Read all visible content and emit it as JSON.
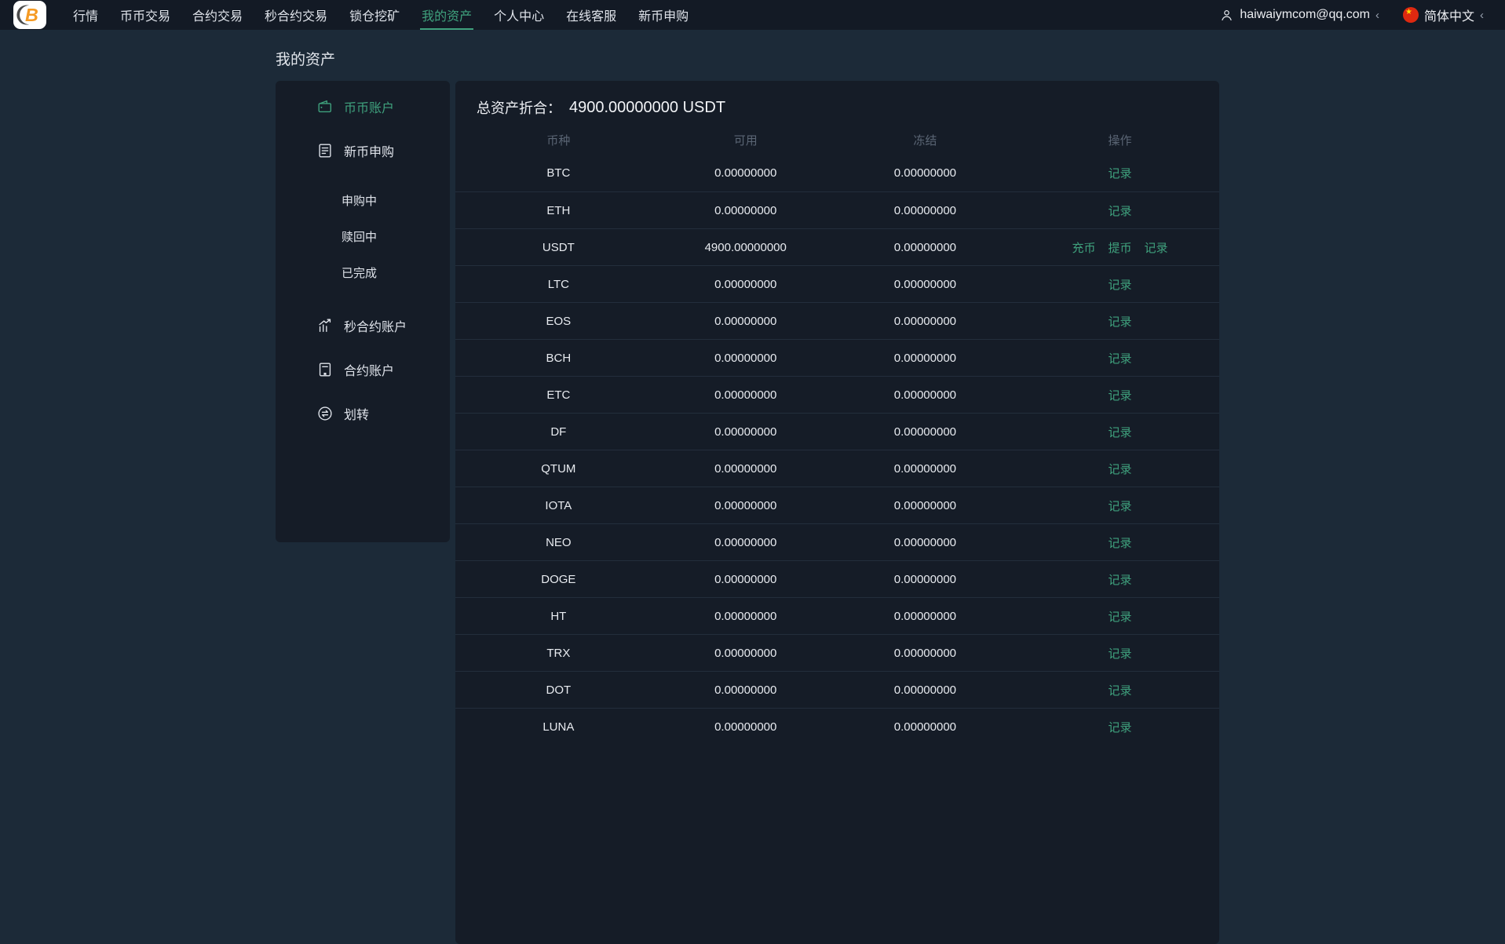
{
  "colors": {
    "nav_bg": "#131a25",
    "page_bg": "#1c2a38",
    "panel_bg": "#151c27",
    "accent": "#3fa17d",
    "muted": "#5a6574",
    "divider": "#232e3c",
    "logo_orange": "#f59a23",
    "flag_red": "#de2910",
    "flag_yellow": "#ffde00"
  },
  "nav": {
    "items": [
      "行情",
      "币币交易",
      "合约交易",
      "秒合约交易",
      "锁仓挖矿",
      "我的资产",
      "个人中心",
      "在线客服",
      "新币申购"
    ],
    "active_index": 5,
    "user_email": "haiwaiymcom@qq.com",
    "user_chevron": "‹",
    "language": "简体中文",
    "lang_chevron": "‹",
    "flag_star": "★"
  },
  "page": {
    "title": "我的资产"
  },
  "sidebar": {
    "items": [
      {
        "label": "币币账户",
        "icon": "wallet-icon",
        "active": true
      },
      {
        "label": "新币申购",
        "icon": "document-icon"
      },
      {
        "label": "申购中",
        "sub": true,
        "first_sub": true
      },
      {
        "label": "赎回中",
        "sub": true
      },
      {
        "label": "已完成",
        "sub": true
      },
      {
        "label": "秒合约账户",
        "icon": "chart-icon",
        "group_first": true
      },
      {
        "label": "合约账户",
        "icon": "contract-icon"
      },
      {
        "label": "划转",
        "icon": "transfer-icon"
      }
    ]
  },
  "assets": {
    "total_label": "总资产折合：",
    "total_value": "4900.00000000 USDT",
    "table": {
      "headers": [
        "币种",
        "可用",
        "冻结",
        "操作"
      ],
      "action_labels": {
        "deposit": "充币",
        "withdraw": "提币",
        "record": "记录"
      },
      "rows": [
        {
          "coin": "BTC",
          "available": "0.00000000",
          "frozen": "0.00000000",
          "actions": [
            "record"
          ]
        },
        {
          "coin": "ETH",
          "available": "0.00000000",
          "frozen": "0.00000000",
          "actions": [
            "record"
          ]
        },
        {
          "coin": "USDT",
          "available": "4900.00000000",
          "frozen": "0.00000000",
          "actions": [
            "deposit",
            "withdraw",
            "record"
          ]
        },
        {
          "coin": "LTC",
          "available": "0.00000000",
          "frozen": "0.00000000",
          "actions": [
            "record"
          ]
        },
        {
          "coin": "EOS",
          "available": "0.00000000",
          "frozen": "0.00000000",
          "actions": [
            "record"
          ]
        },
        {
          "coin": "BCH",
          "available": "0.00000000",
          "frozen": "0.00000000",
          "actions": [
            "record"
          ]
        },
        {
          "coin": "ETC",
          "available": "0.00000000",
          "frozen": "0.00000000",
          "actions": [
            "record"
          ]
        },
        {
          "coin": "DF",
          "available": "0.00000000",
          "frozen": "0.00000000",
          "actions": [
            "record"
          ]
        },
        {
          "coin": "QTUM",
          "available": "0.00000000",
          "frozen": "0.00000000",
          "actions": [
            "record"
          ]
        },
        {
          "coin": "IOTA",
          "available": "0.00000000",
          "frozen": "0.00000000",
          "actions": [
            "record"
          ]
        },
        {
          "coin": "NEO",
          "available": "0.00000000",
          "frozen": "0.00000000",
          "actions": [
            "record"
          ]
        },
        {
          "coin": "DOGE",
          "available": "0.00000000",
          "frozen": "0.00000000",
          "actions": [
            "record"
          ]
        },
        {
          "coin": "HT",
          "available": "0.00000000",
          "frozen": "0.00000000",
          "actions": [
            "record"
          ]
        },
        {
          "coin": "TRX",
          "available": "0.00000000",
          "frozen": "0.00000000",
          "actions": [
            "record"
          ]
        },
        {
          "coin": "DOT",
          "available": "0.00000000",
          "frozen": "0.00000000",
          "actions": [
            "record"
          ]
        },
        {
          "coin": "LUNA",
          "available": "0.00000000",
          "frozen": "0.00000000",
          "actions": [
            "record"
          ]
        }
      ]
    }
  }
}
